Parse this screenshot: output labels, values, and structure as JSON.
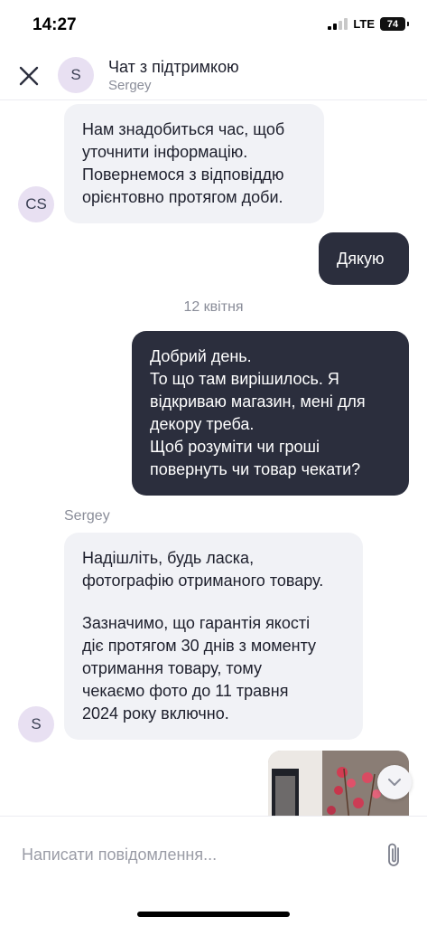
{
  "status_bar": {
    "time": "14:27",
    "network": "LTE",
    "battery": "74"
  },
  "header": {
    "avatar_initial": "S",
    "title": "Чат з підтримкою",
    "subtitle": "Sergey",
    "close_icon": "close-icon"
  },
  "chat": {
    "msg1": {
      "lines": [
        "Нам знадобиться час, щоб",
        "уточнити інформацію.",
        "Повернемося з відповіддю",
        "орієнтовно протягом доби."
      ],
      "avatar": "CS"
    },
    "msg2": {
      "text": "Дякую"
    },
    "date_separator": "12 квітня",
    "msg3": {
      "lines": [
        "Добрий день.",
        "То що там вирішилось. Я",
        "відкриваю магазин, мені для",
        "декору треба.",
        "Щоб розуміти чи гроші",
        "повернуть чи товар чекати?"
      ]
    },
    "msg4": {
      "sender": "Sergey",
      "lines_a": [
        "Надішліть, будь ласка,",
        "фотографію отриманого товару."
      ],
      "lines_b": [
        "Зазначимо, що гарантія якості",
        "діє протягом 30 днів з моменту",
        "отримання товару, тому",
        "чекаємо фото до 11 травня",
        "2024 року включно."
      ],
      "avatar": "S"
    }
  },
  "input": {
    "placeholder": "Написати повідомлення...",
    "attach_icon": "paperclip-icon"
  },
  "colors": {
    "outgoing_bubble": "#2b2e3d",
    "incoming_bubble": "#f1f2f6",
    "avatar_bg": "#e8e0f2",
    "muted_text": "#8a8d99"
  }
}
